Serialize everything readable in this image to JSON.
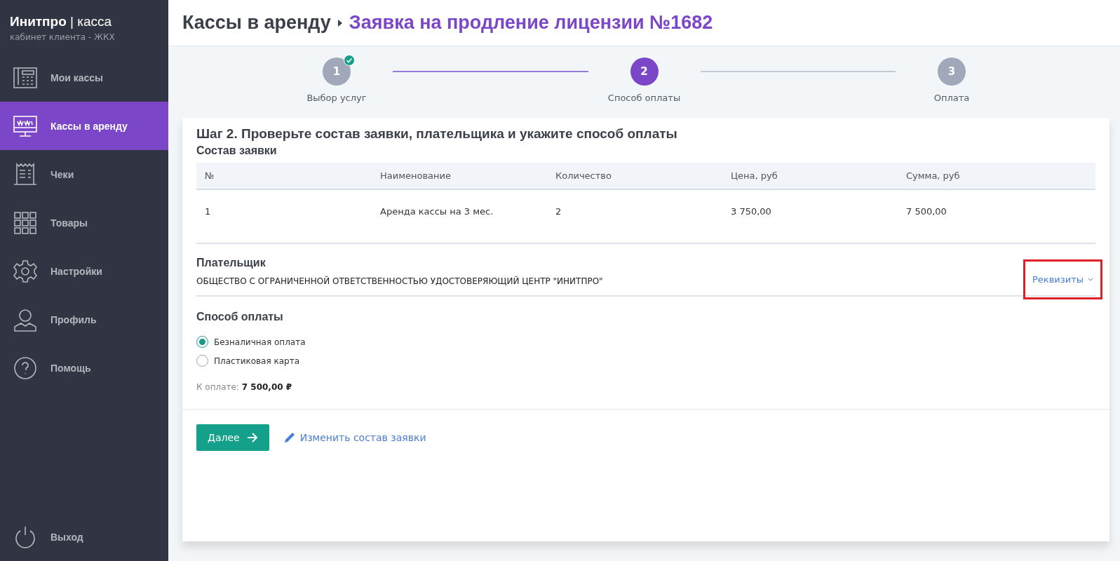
{
  "sidebar": {
    "logo": {
      "brand": "Инитпро",
      "separator": "|",
      "product": "касса",
      "subtitle": "кабинет клиента - ЖКХ"
    },
    "items": [
      {
        "kind": "register",
        "label": "Мои кассы",
        "selected": false
      },
      {
        "kind": "monitor",
        "label": "Кассы в аренду",
        "selected": true
      },
      {
        "kind": "receipt",
        "label": "Чеки",
        "selected": false
      },
      {
        "kind": "grid",
        "label": "Товары",
        "selected": false
      },
      {
        "kind": "gear",
        "label": "Настройки",
        "selected": false
      },
      {
        "kind": "person",
        "label": "Профиль",
        "selected": false
      },
      {
        "kind": "help",
        "label": "Помощь",
        "selected": false
      }
    ],
    "logout": {
      "label": "Выход"
    }
  },
  "header": {
    "breadcrumb": "Кассы в аренду",
    "title": "Заявка на продление лицензии №1682"
  },
  "steps": [
    {
      "number": "1",
      "label": "Выбор услуг",
      "selected": false,
      "done": true
    },
    {
      "number": "2",
      "label": "Способ оплаты",
      "selected": true,
      "done": false
    },
    {
      "number": "3",
      "label": "Оплата",
      "selected": false,
      "done": false
    }
  ],
  "card": {
    "heading": "Шаг 2. Проверьте состав заявки, плательщика и укажите способ оплаты",
    "order": {
      "title": "Состав заявки",
      "columns": [
        "№",
        "Наименование",
        "Количество",
        "Цена, руб",
        "Сумма, руб"
      ],
      "rows": [
        [
          "1",
          "Аренда кассы на 3 мес.",
          "2",
          "3 750,00",
          "7 500,00"
        ]
      ]
    },
    "payer": {
      "title": "Плательщик",
      "name": "ОБЩЕСТВО С ОГРАНИЧЕННОЙ ОТВЕТСТВЕННОСТЬЮ УДОСТОВЕРЯЮЩИЙ ЦЕНТР \"ИНИТПРО\"",
      "details_link": "Реквизиты",
      "highlighted": true
    },
    "payment": {
      "title": "Способ оплаты",
      "options": [
        {
          "label": "Безналичная оплата",
          "selected": true
        },
        {
          "label": "Пластиковая карта",
          "selected": false
        }
      ],
      "total_label": "К оплате:",
      "total": "7 500,00 ₽"
    },
    "next_button": "Далее",
    "edit_link": "Изменить состав заявки"
  }
}
